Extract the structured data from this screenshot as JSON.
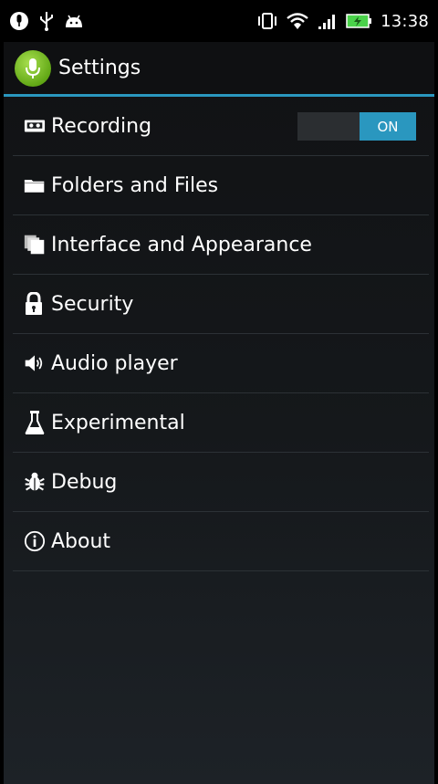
{
  "status_bar": {
    "time": "13:38",
    "left_icons": [
      "voice-recorder-notification-icon",
      "usb-icon",
      "android-debug-icon"
    ],
    "right_icons": [
      "vibrate-icon",
      "wifi-icon",
      "signal-icon",
      "battery-icon"
    ]
  },
  "action_bar": {
    "title": "Settings",
    "accent_color": "#2a97bf"
  },
  "settings": {
    "items": [
      {
        "label": "Recording",
        "icon": "cassette-icon"
      },
      {
        "label": "Folders and Files",
        "icon": "folder-icon"
      },
      {
        "label": "Interface and Appearance",
        "icon": "copy-icon"
      },
      {
        "label": "Security",
        "icon": "lock-icon"
      },
      {
        "label": "Audio player",
        "icon": "speaker-icon"
      },
      {
        "label": "Experimental",
        "icon": "flask-icon"
      },
      {
        "label": "Debug",
        "icon": "bug-icon"
      },
      {
        "label": "About",
        "icon": "info-icon"
      }
    ],
    "recording_toggle": {
      "state_label": "ON",
      "on": true
    }
  }
}
